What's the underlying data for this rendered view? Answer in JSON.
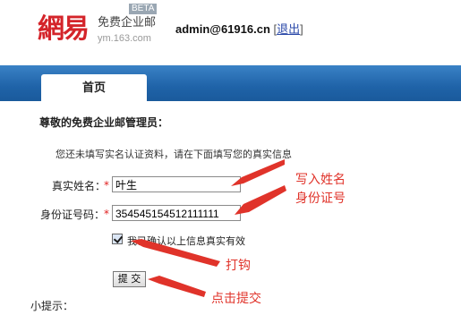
{
  "header": {
    "logo_main": "網易",
    "logo_sub": "免费企业邮",
    "logo_domain": "ym.163.com",
    "beta_badge": "BETA",
    "account": "admin@61916.cn",
    "bracket_open": "[",
    "logout_label": "退出",
    "bracket_close": "]"
  },
  "nav": {
    "tabs": [
      {
        "label": "首页",
        "active": true
      }
    ],
    "bar_color": "#2a6db5"
  },
  "form": {
    "greeting": "尊敬的免费企业邮管理员：",
    "notice": "您还未填写实名认证资料，请在下面填写您的真实信息",
    "name_label": "真实姓名：",
    "id_label": "身份证号码：",
    "required_mark": "*",
    "name_value": "叶生",
    "id_value": "354545154512111111",
    "confirm_checked": true,
    "confirm_label": "我已确认以上信息真实有效",
    "submit_label": "提 交",
    "tip_label": "小提示："
  },
  "annotations": {
    "fill_in_name": "写入姓名",
    "id_number": "身份证号",
    "check": "打钩",
    "click_submit": "点击提交",
    "color": "#e0332a"
  }
}
